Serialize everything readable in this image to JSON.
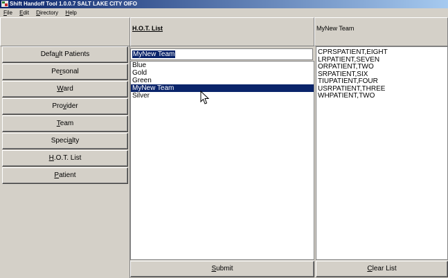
{
  "window": {
    "title": "Shift Handoff Tool 1.0.0.7  SALT LAKE CITY OIFO"
  },
  "menu": [
    {
      "label": "File",
      "key": "F",
      "rest": "ile"
    },
    {
      "label": "Edit",
      "key": "E",
      "rest": "dit"
    },
    {
      "label": "Directory",
      "key": "D",
      "rest": "irectory"
    },
    {
      "label": "Help",
      "key": "H",
      "rest": "elp"
    }
  ],
  "headers": {
    "hot_list": "H.O.T. List",
    "team": "MyNew Team"
  },
  "nav": [
    {
      "pre": "Defa",
      "key": "u",
      "post": "lt Patients"
    },
    {
      "pre": "Pe",
      "key": "r",
      "post": "sonal"
    },
    {
      "pre": "",
      "key": "W",
      "post": "ard"
    },
    {
      "pre": "Pro",
      "key": "v",
      "post": "ider"
    },
    {
      "pre": "",
      "key": "T",
      "post": "eam"
    },
    {
      "pre": "Speci",
      "key": "a",
      "post": "lty"
    },
    {
      "pre": "",
      "key": "H",
      "post": ".O.T. List"
    },
    {
      "pre": "",
      "key": "P",
      "post": "atient"
    }
  ],
  "hot_input": {
    "value": "MyNew Team"
  },
  "hot_items": [
    "Blue",
    "Gold",
    "Green",
    "MyNew Team",
    "Silver"
  ],
  "selected_index": 3,
  "patients": [
    "CPRSPATIENT,EIGHT",
    "LRPATIENT,SEVEN",
    "ORPATIENT,TWO",
    "SRPATIENT,SIX",
    "TIUPATIENT,FOUR",
    "USRPATIENT,THREE",
    "WHPATIENT,TWO"
  ],
  "buttons": {
    "submit": {
      "key": "S",
      "rest": "ubmit"
    },
    "clear": {
      "key": "C",
      "rest": "lear List"
    }
  }
}
